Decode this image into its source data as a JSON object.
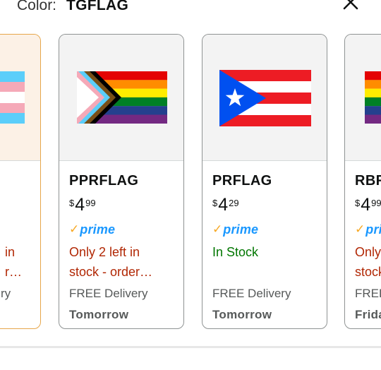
{
  "header": {
    "color_label": "Color:",
    "color_value": "TGFLAG",
    "close_icon": "close-icon"
  },
  "cards": [
    {
      "sku": "",
      "price": {
        "currency": "",
        "whole": "",
        "fraction": ""
      },
      "prime": "",
      "stock": {
        "line1": "in",
        "line2": "r…"
      },
      "delivery": {
        "label": "ry",
        "day": ""
      }
    },
    {
      "sku": "PPRFLAG",
      "price": {
        "currency": "$",
        "whole": "4",
        "fraction": "99"
      },
      "prime": "prime",
      "stock": {
        "line1": "Only 2 left in",
        "line2": "stock - order…"
      },
      "delivery": {
        "label": "FREE Delivery",
        "day": "Tomorrow"
      }
    },
    {
      "sku": "PRFLAG",
      "price": {
        "currency": "$",
        "whole": "4",
        "fraction": "29"
      },
      "prime": "prime",
      "stock": {
        "line1": "In Stock",
        "line2": ""
      },
      "delivery": {
        "label": "FREE Delivery",
        "day": "Tomorrow"
      }
    },
    {
      "sku": "RBF",
      "price": {
        "currency": "$",
        "whole": "4",
        "fraction": "99"
      },
      "prime": "pri",
      "stock": {
        "line1": "Only",
        "line2": "stock"
      },
      "delivery": {
        "label": "FREE",
        "day": "Frida"
      }
    }
  ],
  "colors": {
    "accent_border": "#e6a64a",
    "prime_blue": "#1a98ff",
    "prime_check": "#f7a823",
    "low_stock": "#b12704",
    "in_stock": "#007600"
  }
}
